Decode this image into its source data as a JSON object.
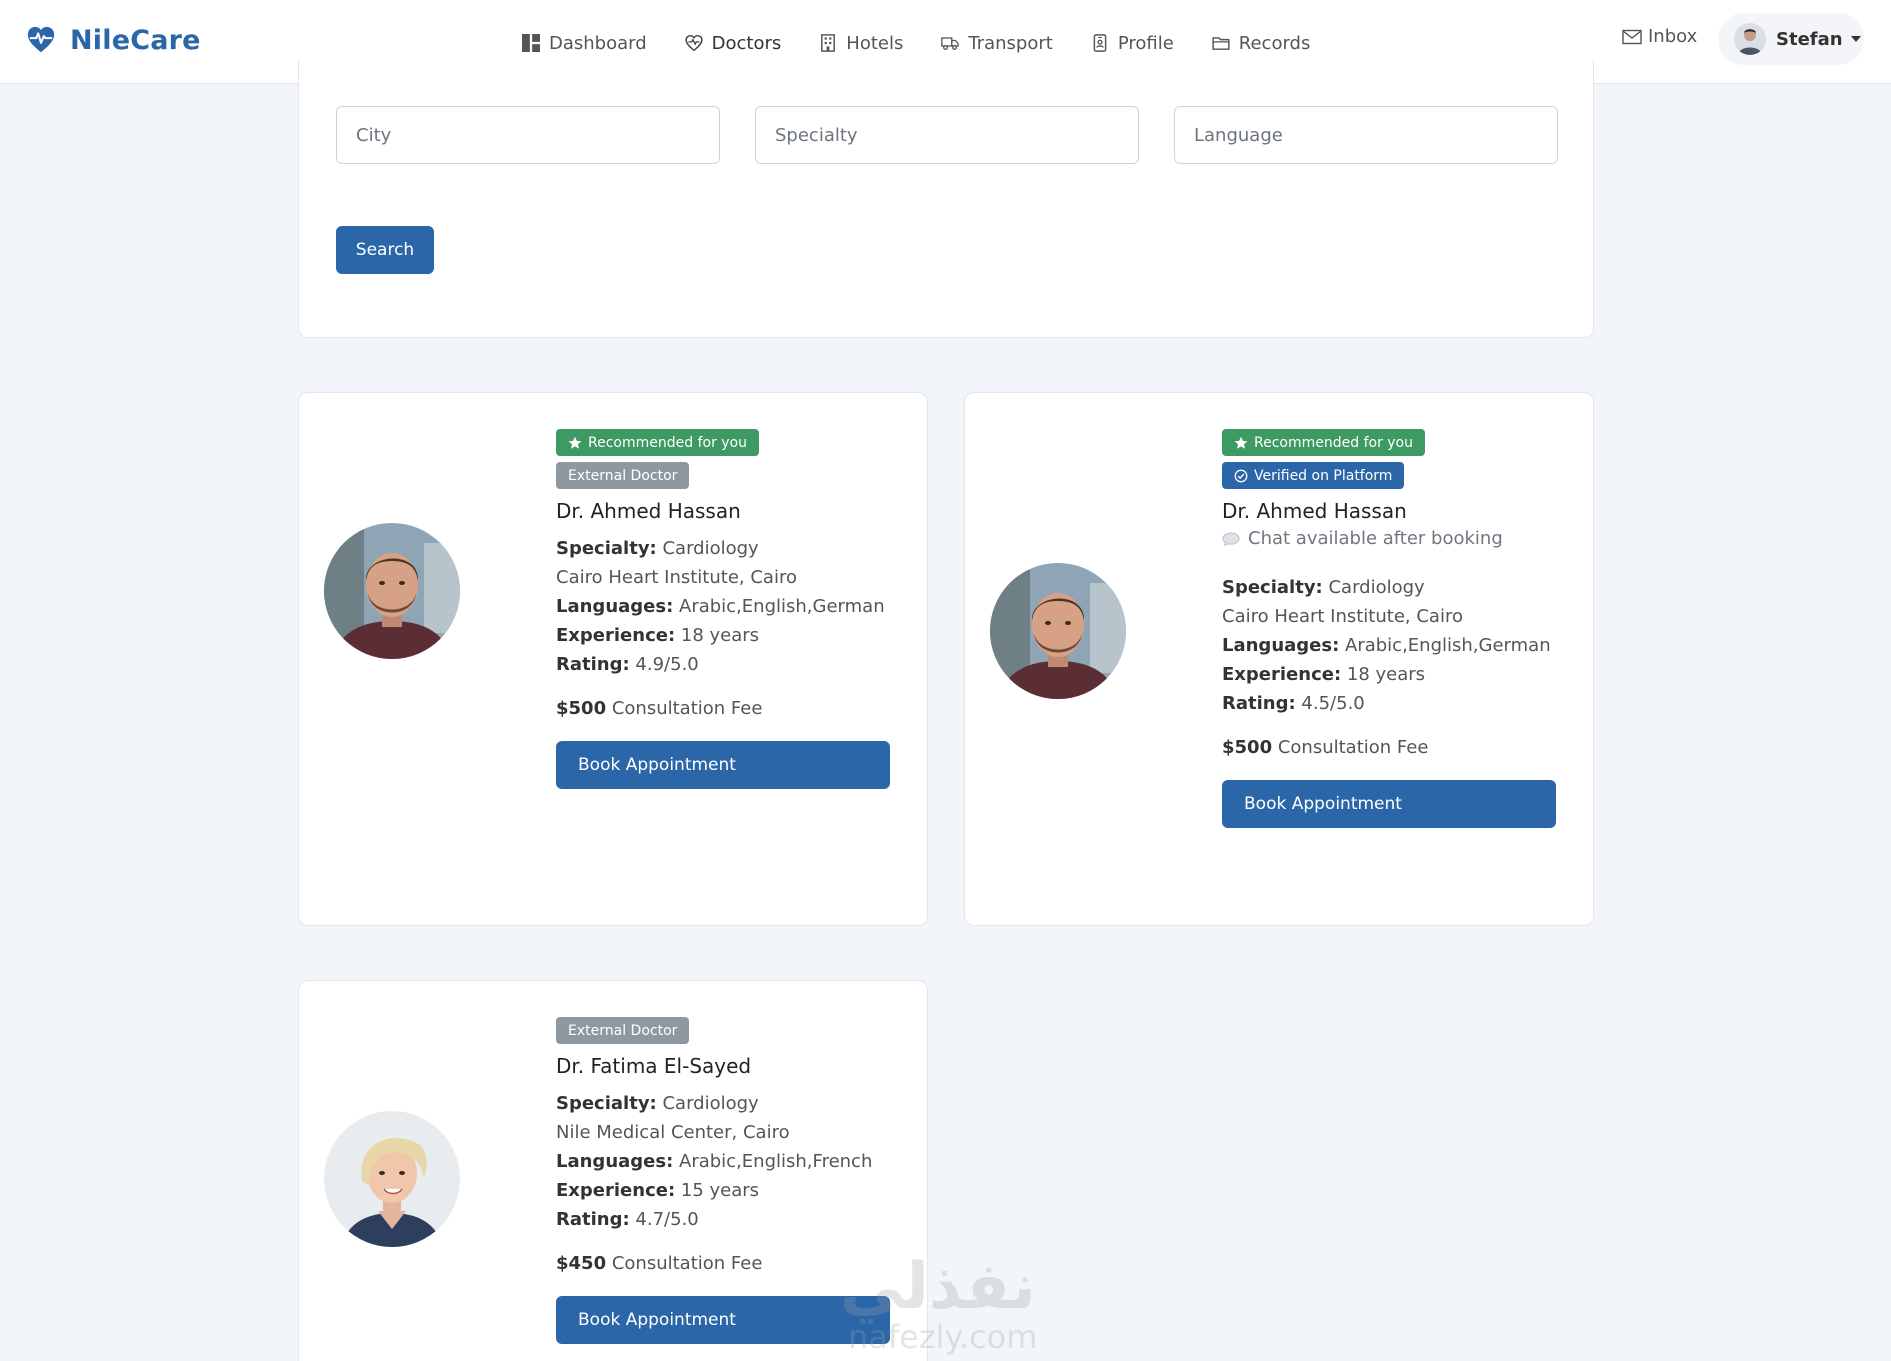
{
  "brand": {
    "name": "NileCare",
    "logo_icon": "heart-pulse-icon",
    "accent_color": "#2b66a8"
  },
  "nav": {
    "items": [
      {
        "label": "Dashboard",
        "icon": "dashboard-icon",
        "active": false
      },
      {
        "label": "Doctors",
        "icon": "heart-pulse-icon",
        "active": true
      },
      {
        "label": "Hotels",
        "icon": "building-icon",
        "active": false
      },
      {
        "label": "Transport",
        "icon": "truck-icon",
        "active": false
      },
      {
        "label": "Profile",
        "icon": "id-badge-icon",
        "active": false
      },
      {
        "label": "Records",
        "icon": "folder-icon",
        "active": false
      }
    ],
    "inbox_label": "Inbox",
    "user_name": "Stefan"
  },
  "search": {
    "city_placeholder": "City",
    "specialty_placeholder": "Specialty",
    "language_placeholder": "Language",
    "button_label": "Search"
  },
  "doctors": [
    {
      "badges": [
        "Recommended for you",
        "External Doctor"
      ],
      "name": "Dr. Ahmed Hassan",
      "specialty_label": "Specialty:",
      "specialty": "Cardiology",
      "hospital": "Cairo Heart Institute, Cairo",
      "languages_label": "Languages:",
      "languages": "Arabic,English,German",
      "experience_label": "Experience:",
      "experience": "18 years",
      "rating_label": "Rating:",
      "rating": "4.9/5.0",
      "fee": "$500",
      "fee_label": "Consultation Fee",
      "book_label": "Book Appointment"
    },
    {
      "badges": [
        "Recommended for you",
        "Verified on Platform"
      ],
      "name": "Dr. Ahmed Hassan",
      "chat_note": "Chat available after booking",
      "specialty_label": "Specialty:",
      "specialty": "Cardiology",
      "hospital": "Cairo Heart Institute, Cairo",
      "languages_label": "Languages:",
      "languages": "Arabic,English,German",
      "experience_label": "Experience:",
      "experience": "18 years",
      "rating_label": "Rating:",
      "rating": "4.5/5.0",
      "fee": "$500",
      "fee_label": "Consultation Fee",
      "book_label": "Book Appointment"
    },
    {
      "badges": [
        "External Doctor"
      ],
      "name": "Dr. Fatima El-Sayed",
      "specialty_label": "Specialty:",
      "specialty": "Cardiology",
      "hospital": "Nile Medical Center, Cairo",
      "languages_label": "Languages:",
      "languages": "Arabic,English,French",
      "experience_label": "Experience:",
      "experience": "15 years",
      "rating_label": "Rating:",
      "rating": "4.7/5.0",
      "fee": "$450",
      "fee_label": "Consultation Fee",
      "book_label": "Book Appointment"
    }
  ],
  "watermark": {
    "arabic": "نفذلي",
    "latin": "nafezly.com"
  },
  "colors": {
    "recommended": "#3e9a63",
    "external": "#8f97a0",
    "verified": "#2b66a8"
  }
}
